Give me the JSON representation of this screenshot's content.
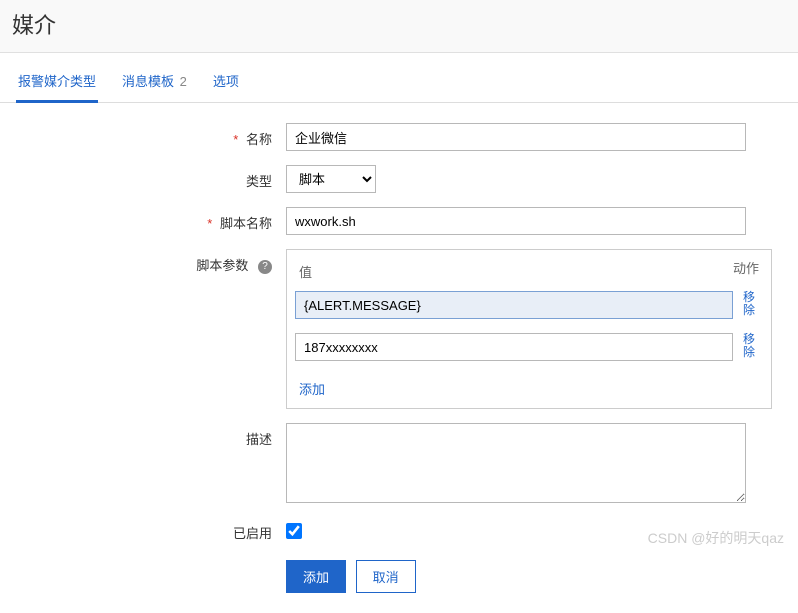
{
  "page": {
    "title": "媒介"
  },
  "tabs": {
    "items": [
      {
        "label": "报警媒介类型",
        "count": ""
      },
      {
        "label": "消息模板",
        "count": "2"
      },
      {
        "label": "选项",
        "count": ""
      }
    ]
  },
  "form": {
    "name": {
      "label": "名称",
      "value": "企业微信"
    },
    "type": {
      "label": "类型",
      "value": "脚本"
    },
    "script_name": {
      "label": "脚本名称",
      "value": "wxwork.sh"
    },
    "script_params": {
      "label": "脚本参数",
      "header_value": "值",
      "header_action": "动作",
      "rows": [
        {
          "value": "{ALERT.MESSAGE}",
          "action": "移除"
        },
        {
          "value": "187xxxxxxxx",
          "action": "移除"
        }
      ],
      "add_label": "添加"
    },
    "description": {
      "label": "描述",
      "value": ""
    },
    "enabled": {
      "label": "已启用",
      "checked": true
    }
  },
  "buttons": {
    "submit": "添加",
    "cancel": "取消"
  },
  "watermark": "CSDN @好的明天qaz"
}
